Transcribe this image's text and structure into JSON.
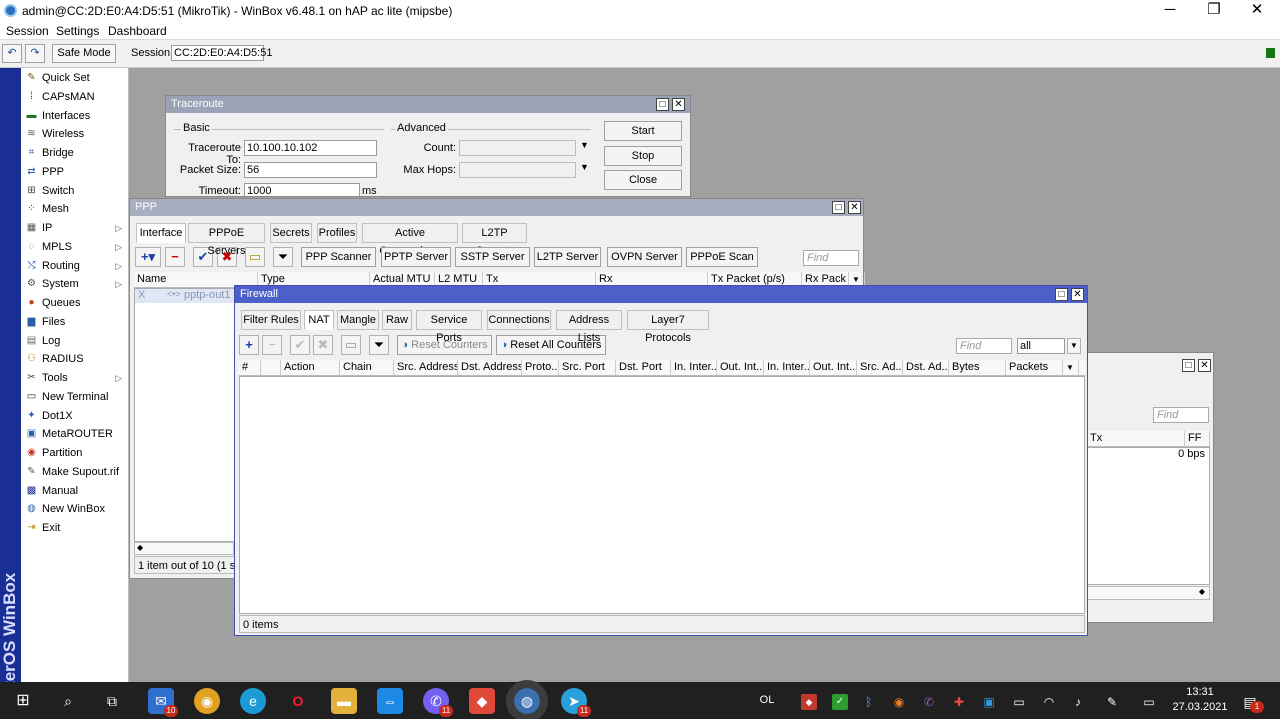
{
  "window": {
    "title": "admin@CC:2D:E0:A4:D5:51 (MikroTik) - WinBox v6.48.1 on hAP ac lite (mipsbe)",
    "minimize": "─",
    "maximize": "❐",
    "close": "✕"
  },
  "menubar": {
    "session": "Session",
    "settings": "Settings",
    "dashboard": "Dashboard"
  },
  "toolbar": {
    "undo": "↶",
    "redo": "↷",
    "safe_mode": "Safe Mode",
    "session_label": "Session:",
    "session_value": "CC:2D:E0:A4:D5:51"
  },
  "sidebar": {
    "vertical_brand": "RouterOS WinBox",
    "items": [
      {
        "label": "Quick Set",
        "icon": "wand-icon",
        "glyph": "✎",
        "color": "#7a5a00",
        "arrow": ""
      },
      {
        "label": "CAPsMAN",
        "icon": "capsman-icon",
        "glyph": "⁞",
        "color": "#333333",
        "arrow": ""
      },
      {
        "label": "Interfaces",
        "icon": "interfaces-icon",
        "glyph": "▬",
        "color": "#1d7a1d",
        "arrow": ""
      },
      {
        "label": "Wireless",
        "icon": "wireless-icon",
        "glyph": "≋",
        "color": "#555555",
        "arrow": ""
      },
      {
        "label": "Bridge",
        "icon": "bridge-icon",
        "glyph": "⌗",
        "color": "#2b5fa8",
        "arrow": ""
      },
      {
        "label": "PPP",
        "icon": "ppp-icon",
        "glyph": "⇄",
        "color": "#2b5fa8",
        "arrow": ""
      },
      {
        "label": "Switch",
        "icon": "switch-icon",
        "glyph": "⊞",
        "color": "#444444",
        "arrow": ""
      },
      {
        "label": "Mesh",
        "icon": "mesh-icon",
        "glyph": "⁘",
        "color": "#333333",
        "arrow": ""
      },
      {
        "label": "IP",
        "icon": "ip-icon",
        "glyph": "▦",
        "color": "#555555",
        "arrow": "▷"
      },
      {
        "label": "MPLS",
        "icon": "mpls-icon",
        "glyph": "◌",
        "color": "#2b5fa8",
        "arrow": "▷"
      },
      {
        "label": "Routing",
        "icon": "routing-icon",
        "glyph": "⤭",
        "color": "#2b5fa8",
        "arrow": "▷"
      },
      {
        "label": "System",
        "icon": "system-icon",
        "glyph": "⚙",
        "color": "#555555",
        "arrow": "▷"
      },
      {
        "label": "Queues",
        "icon": "queues-icon",
        "glyph": "●",
        "color": "#c0392b",
        "arrow": ""
      },
      {
        "label": "Files",
        "icon": "files-icon",
        "glyph": "▆",
        "color": "#2b5fa8",
        "arrow": ""
      },
      {
        "label": "Log",
        "icon": "log-icon",
        "glyph": "▤",
        "color": "#666666",
        "arrow": ""
      },
      {
        "label": "RADIUS",
        "icon": "radius-icon",
        "glyph": "⚇",
        "color": "#b8860b",
        "arrow": ""
      },
      {
        "label": "Tools",
        "icon": "tools-icon",
        "glyph": "✂",
        "color": "#444444",
        "arrow": "▷"
      },
      {
        "label": "New Terminal",
        "icon": "terminal-icon",
        "glyph": "▭",
        "color": "#222222",
        "arrow": ""
      },
      {
        "label": "Dot1X",
        "icon": "dot1x-icon",
        "glyph": "✦",
        "color": "#2b5fa8",
        "arrow": ""
      },
      {
        "label": "MetaROUTER",
        "icon": "metarouter-icon",
        "glyph": "▣",
        "color": "#2b5fa8",
        "arrow": ""
      },
      {
        "label": "Partition",
        "icon": "partition-icon",
        "glyph": "◉",
        "color": "#c0392b",
        "arrow": ""
      },
      {
        "label": "Make Supout.rif",
        "icon": "supout-icon",
        "glyph": "✎",
        "color": "#555555",
        "arrow": ""
      },
      {
        "label": "Manual",
        "icon": "manual-icon",
        "glyph": "▩",
        "color": "#1a2f94",
        "arrow": ""
      },
      {
        "label": "New WinBox",
        "icon": "winbox-icon",
        "glyph": "◍",
        "color": "#2b5fa8",
        "arrow": ""
      },
      {
        "label": "Exit",
        "icon": "exit-icon",
        "glyph": "⇥",
        "color": "#b8860b",
        "arrow": ""
      }
    ]
  },
  "traceroute": {
    "title": "Traceroute",
    "basic_label": "Basic",
    "advanced_label": "Advanced",
    "to_label": "Traceroute To:",
    "to_value": "10.100.10.102",
    "size_label": "Packet Size:",
    "size_value": "56",
    "timeout_label": "Timeout:",
    "timeout_value": "1000",
    "timeout_unit": "ms",
    "count_label": "Count:",
    "hops_label": "Max Hops:",
    "start": "Start",
    "stop": "Stop",
    "close": "Close"
  },
  "ppp": {
    "title": "PPP",
    "tabs": [
      "Interface",
      "PPPoE Servers",
      "Secrets",
      "Profiles",
      "Active Connections",
      "L2TP Secrets"
    ],
    "buttons": [
      "PPP Scanner",
      "PPTP Server",
      "SSTP Server",
      "L2TP Server",
      "OVPN Server",
      "PPPoE Scan"
    ],
    "find_placeholder": "Find",
    "columns": [
      "Name",
      "Type",
      "Actual MTU",
      "L2 MTU",
      "Tx",
      "Rx",
      "Tx Packet (p/s)",
      "Rx Pack"
    ],
    "row_flag": "X",
    "row_name": "pptp-out1",
    "status": "1 item out of 10 (1 selected)"
  },
  "hidden_window": {
    "find_placeholder": "Find",
    "col_tx": "Tx",
    "col_ff": "FF",
    "value": "0 bps"
  },
  "firewall": {
    "title": "Firewall",
    "tabs": [
      "Filter Rules",
      "NAT",
      "Mangle",
      "Raw",
      "Service Ports",
      "Connections",
      "Address Lists",
      "Layer7 Protocols"
    ],
    "reset_counters": "Reset Counters",
    "reset_all": "Reset All Counters",
    "find_placeholder": "Find",
    "filter_value": "all",
    "columns": [
      "#",
      "",
      "Action",
      "Chain",
      "Src. Address",
      "Dst. Address",
      "Proto...",
      "Src. Port",
      "Dst. Port",
      "In. Inter...",
      "Out. Int...",
      "In. Inter...",
      "Out. Int...",
      "Src. Ad...",
      "Dst. Ad...",
      "Bytes",
      "Packets"
    ],
    "status": "0 items"
  },
  "taskbar": {
    "mail_badge": "10",
    "viber_badge": "11",
    "telegram_badge": "11",
    "lang": "OL",
    "time": "13:31",
    "date": "27.03.2021",
    "notif_badge": "1"
  }
}
